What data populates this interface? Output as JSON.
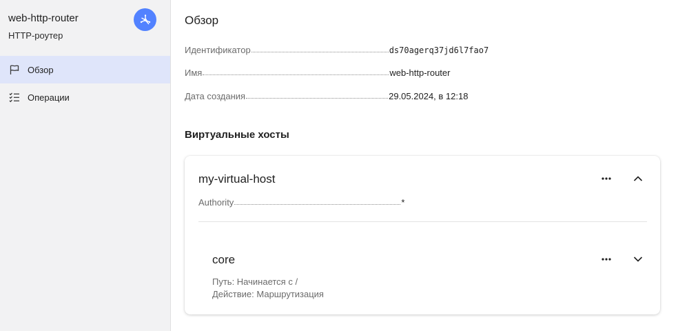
{
  "sidebar": {
    "title": "web-http-router",
    "subtitle": "HTTP-роутер",
    "badge_icon": "router-icon",
    "items": [
      {
        "label": "Обзор",
        "icon": "flag-icon",
        "active": true
      },
      {
        "label": "Операции",
        "icon": "checklist-icon",
        "active": false
      }
    ]
  },
  "main": {
    "title": "Обзор",
    "props": [
      {
        "key": "Идентификатор",
        "value": "ds70agerq37jd6l7fao7"
      },
      {
        "key": "Имя",
        "value": "web-http-router"
      },
      {
        "key": "Дата создания",
        "value": "29.05.2024, в 12:18"
      }
    ],
    "virtual_hosts_title": "Виртуальные хосты",
    "virtual_host": {
      "name": "my-virtual-host",
      "authority_label": "Authority",
      "authority_value": "*",
      "route": {
        "name": "core",
        "path": "Путь: Начинается с /",
        "action": "Действие: Маршрутизация"
      }
    }
  },
  "colors": {
    "accent": "#5282ff",
    "active_nav_bg": "#dfe5fa",
    "sidebar_bg": "#f2f2f3"
  }
}
